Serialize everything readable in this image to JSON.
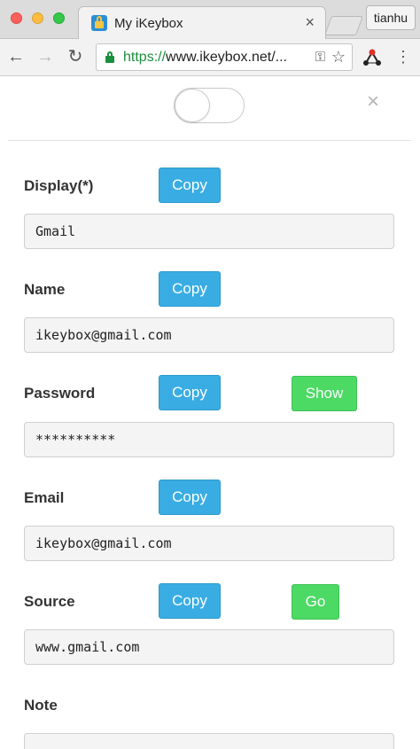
{
  "browser": {
    "tab_title": "My iKeybox",
    "tab_close": "×",
    "profile_name": "tianhu",
    "url_scheme": "https://",
    "url_rest": "www.ikeybox.net/...",
    "icons": {
      "back": "arrow-left",
      "forward": "arrow-right",
      "reload": "reload",
      "secure": "lock",
      "key": "key",
      "star": "star",
      "extension": "ikeybox-extension",
      "menu": "vertical-ellipsis"
    }
  },
  "page": {
    "close_symbol": "×",
    "fields": {
      "display": {
        "label": "Display(*)",
        "copy": "Copy",
        "value": "Gmail"
      },
      "name": {
        "label": "Name",
        "copy": "Copy",
        "value": "ikeybox@gmail.com"
      },
      "password": {
        "label": "Password",
        "copy": "Copy",
        "show": "Show",
        "value": "**********"
      },
      "email": {
        "label": "Email",
        "copy": "Copy",
        "value": "ikeybox@gmail.com"
      },
      "source": {
        "label": "Source",
        "copy": "Copy",
        "go": "Go",
        "value": "www.gmail.com"
      },
      "note": {
        "label": "Note",
        "value": ""
      }
    }
  },
  "colors": {
    "copy_button": "#39ade3",
    "action_button": "#4cd964",
    "url_secure": "#1a8f3c"
  }
}
